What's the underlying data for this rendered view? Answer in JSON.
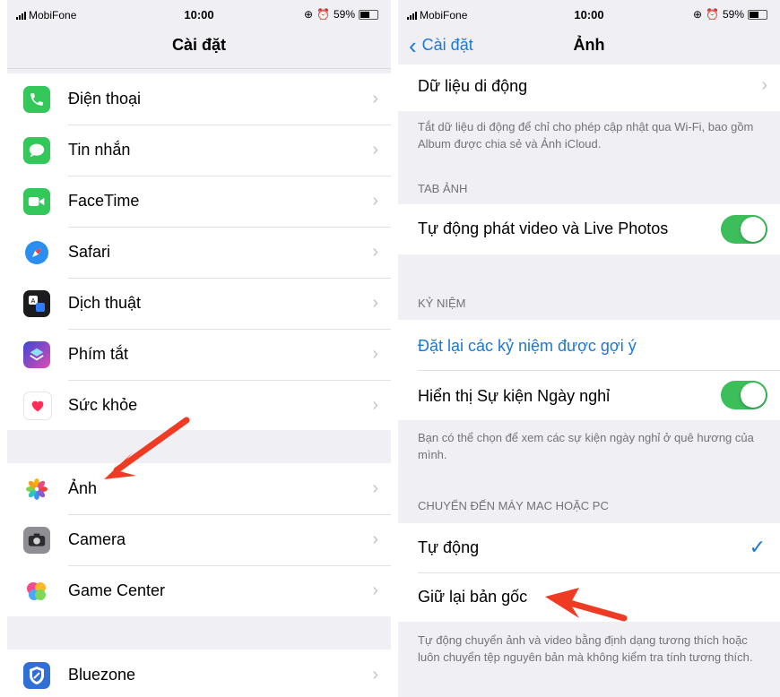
{
  "left": {
    "status": {
      "carrier": "MobiFone",
      "time": "10:00",
      "battery": "59%"
    },
    "title": "Cài đặt",
    "items1": [
      {
        "label": "Điện thoại",
        "icon": "phone-icon",
        "color": "#34c759"
      },
      {
        "label": "Tin nhắn",
        "icon": "message-icon",
        "color": "#34c759"
      },
      {
        "label": "FaceTime",
        "icon": "facetime-icon",
        "color": "#34c759"
      },
      {
        "label": "Safari",
        "icon": "safari-icon",
        "color": "#1e90ff"
      },
      {
        "label": "Dịch thuật",
        "icon": "translate-icon",
        "color": "#1c1c1e"
      },
      {
        "label": "Phím tắt",
        "icon": "shortcuts-icon",
        "color": "#3b3bd4"
      },
      {
        "label": "Sức khỏe",
        "icon": "health-icon",
        "color": "#ffffff"
      }
    ],
    "items2": [
      {
        "label": "Ảnh",
        "icon": "photos-icon",
        "color": "#ffffff"
      },
      {
        "label": "Camera",
        "icon": "camera-icon",
        "color": "#8e8e93"
      },
      {
        "label": "Game Center",
        "icon": "game-center-icon",
        "color": "#ffffff"
      }
    ],
    "items3": [
      {
        "label": "Bluezone",
        "icon": "bluezone-icon",
        "color": "#2f6fd6"
      }
    ]
  },
  "right": {
    "status": {
      "carrier": "MobiFone",
      "time": "10:00",
      "battery": "59%"
    },
    "back": "Cài đặt",
    "title": "Ảnh",
    "mobile_data": "Dữ liệu di động",
    "mobile_caption": "Tắt dữ liệu di động để chỉ cho phép cập nhật qua Wi-Fi, bao gồm Album được chia sẻ và Ảnh iCloud.",
    "tab_header": "TAB ẢNH",
    "autoplay": "Tự động phát video và Live Photos",
    "autoplay_on": true,
    "memories_header": "KỶ NIỆM",
    "reset_memories": "Đặt lại các kỷ niệm được gợi ý",
    "show_holiday": "Hiển thị Sự kiện Ngày nghỉ",
    "show_holiday_on": true,
    "holiday_caption": "Bạn có thể chọn để xem các sự kiện ngày nghỉ ở quê hương của mình.",
    "transfer_header": "CHUYỂN ĐẾN MÁY MAC HOẶC PC",
    "automatic": "Tự động",
    "keep_originals": "Giữ lại bản gốc",
    "transfer_caption": "Tự động chuyển ảnh và video bằng định dạng tương thích hoặc luôn chuyển tệp nguyên bản mà không kiểm tra tính tương thích."
  }
}
